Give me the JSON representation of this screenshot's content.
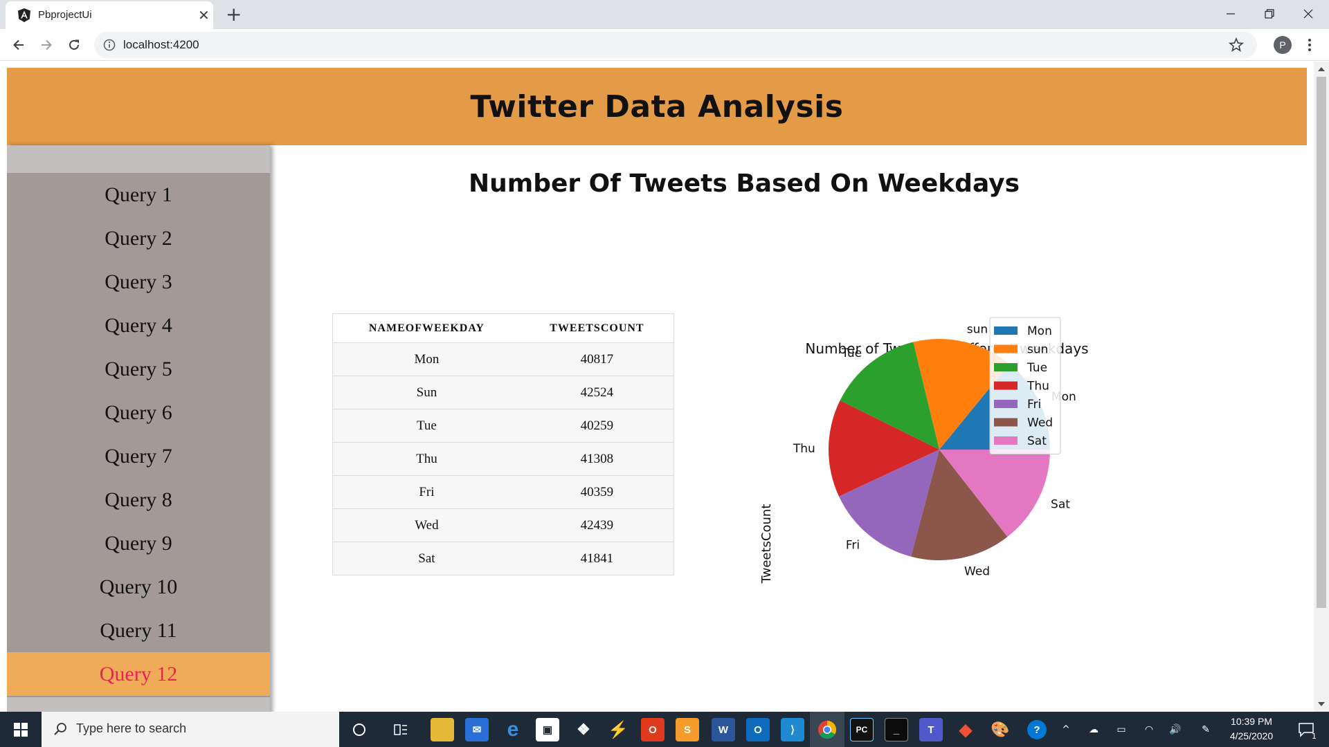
{
  "browser": {
    "tab_title": "PbprojectUi",
    "url": "localhost:4200",
    "profile_initial": "P"
  },
  "header": {
    "title": "Twitter Data Analysis"
  },
  "sidebar": {
    "items": [
      {
        "label": "Query 1"
      },
      {
        "label": "Query 2"
      },
      {
        "label": "Query 3"
      },
      {
        "label": "Query 4"
      },
      {
        "label": "Query 5"
      },
      {
        "label": "Query 6"
      },
      {
        "label": "Query 7"
      },
      {
        "label": "Query 8"
      },
      {
        "label": "Query 9"
      },
      {
        "label": "Query 10"
      },
      {
        "label": "Query 11"
      },
      {
        "label": "Query 12"
      }
    ],
    "active_index": 11
  },
  "main": {
    "title": "Number Of Tweets Based On Weekdays",
    "table": {
      "headers": [
        "NAMEOFWEEKDAY",
        "TWEETSCOUNT"
      ],
      "rows": [
        [
          "Mon",
          "40817"
        ],
        [
          "Sun",
          "42524"
        ],
        [
          "Tue",
          "40259"
        ],
        [
          "Thu",
          "41308"
        ],
        [
          "Fri",
          "40359"
        ],
        [
          "Wed",
          "42439"
        ],
        [
          "Sat",
          "41841"
        ]
      ]
    }
  },
  "chart_data": {
    "type": "pie",
    "title": "Number of Tweets on different weekdays",
    "ylabel": "TweetsCount",
    "categories": [
      "Mon",
      "sun",
      "Tue",
      "Thu",
      "Fri",
      "Wed",
      "Sat"
    ],
    "values": [
      40817,
      42524,
      40259,
      41308,
      40359,
      42439,
      41841
    ],
    "colors": [
      "#1f77b4",
      "#ff7f0e",
      "#2ca02c",
      "#d62728",
      "#9467bd",
      "#8c564b",
      "#e377c2"
    ],
    "start_angle_deg": 0,
    "direction": "counterclockwise",
    "legend_position": "top-right"
  },
  "taskbar": {
    "search_placeholder": "Type here to search",
    "time": "10:39 PM",
    "date": "4/25/2020",
    "notification_count": "1"
  }
}
